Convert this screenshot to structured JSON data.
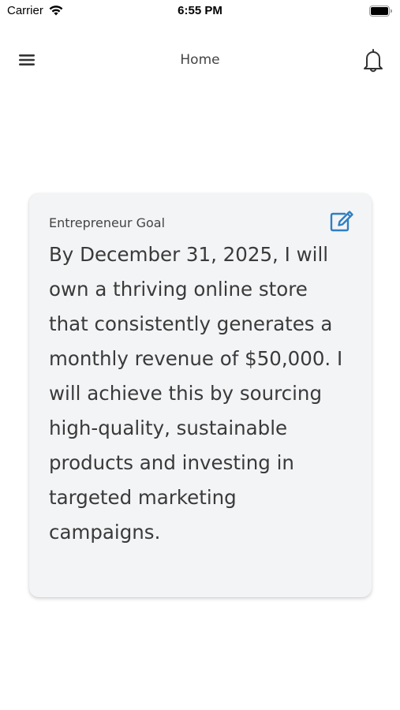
{
  "status_bar": {
    "carrier": "Carrier",
    "time": "6:55 PM",
    "icons": [
      "wifi-icon",
      "battery-icon"
    ]
  },
  "nav": {
    "title": "Home",
    "left_icon": "hamburger-menu-icon",
    "right_icon": "bell-icon"
  },
  "goal_card": {
    "label": "Entrepreneur Goal",
    "text": "By December 31, 2025, I will own a thriving online store that consistently generates a monthly revenue of $50,000. I will achieve this by sourcing high-quality, sustainable products and investing in targeted marketing campaigns.",
    "edit_icon": "edit-icon"
  },
  "colors": {
    "accent": "#2f7fc1",
    "card_background": "#f3f4f6",
    "text": "#3a3a3a"
  }
}
